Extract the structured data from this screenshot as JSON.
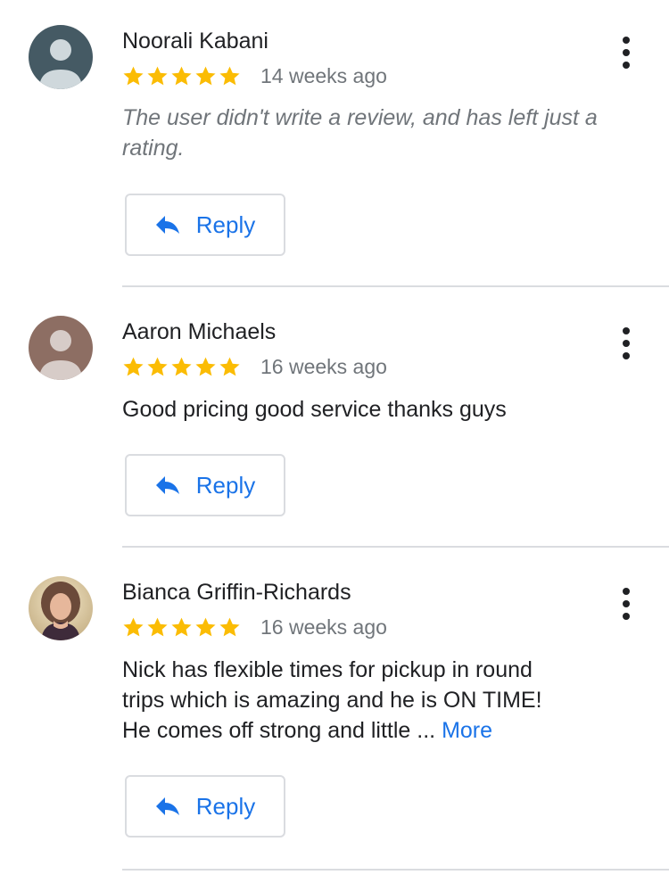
{
  "reviews": [
    {
      "name": "Noorali Kabani",
      "rating": 5,
      "time": "14 weeks ago",
      "text": "The user didn't write a review, and has left just a rating.",
      "text_style": "italic",
      "avatar": "default-person-icon",
      "avatar_bg": "#455a64",
      "reply_label": "Reply"
    },
    {
      "name": "Aaron Michaels",
      "rating": 5,
      "time": "16 weeks ago",
      "text": "Good pricing good service thanks guys",
      "text_style": "normal",
      "avatar": "default-person-icon",
      "avatar_bg": "#8d6e63",
      "reply_label": "Reply"
    },
    {
      "name": "Bianca Griffin-Richards",
      "rating": 5,
      "time": "16 weeks ago",
      "text_lines": [
        "Nick has flexible times for pickup in round",
        "trips which is amazing and he is ON TIME!",
        "He comes off strong and little ..."
      ],
      "more_label": "More",
      "text_style": "normal",
      "avatar": "profile-photo",
      "reply_label": "Reply"
    }
  ],
  "colors": {
    "star": "#fbbc04",
    "link": "#1a73e8",
    "muted": "#70757a",
    "divider": "#dadce0"
  }
}
